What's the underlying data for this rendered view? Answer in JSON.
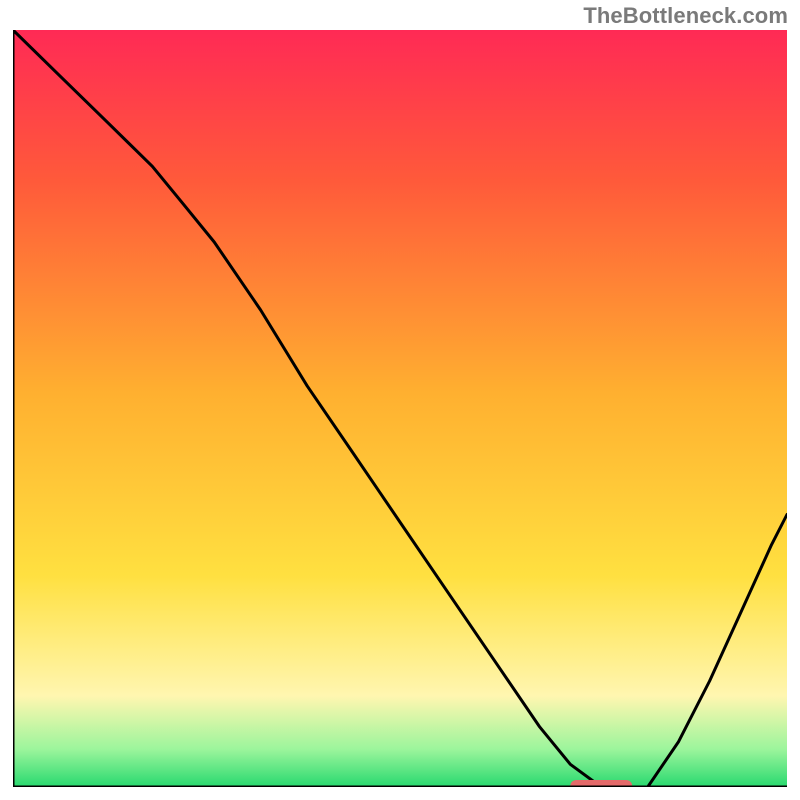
{
  "watermark": "TheBottleneck.com",
  "colors": {
    "gradient_top": "#ff2a55",
    "gradient_upper": "#ff5a3a",
    "gradient_mid": "#ffb030",
    "gradient_low": "#ffe040",
    "gradient_pale": "#fff6b0",
    "gradient_green_light": "#9cf59c",
    "gradient_green": "#28d96f",
    "curve": "#000000",
    "marker": "#e46a6a",
    "axis": "#000000"
  },
  "chart_data": {
    "type": "line",
    "title": "",
    "xlabel": "",
    "ylabel": "",
    "xlim": [
      0,
      100
    ],
    "ylim": [
      0,
      100
    ],
    "series": [
      {
        "name": "bottleneck-curve",
        "x": [
          0,
          6,
          12,
          18,
          22,
          26,
          32,
          38,
          44,
          50,
          56,
          62,
          68,
          72,
          76,
          78,
          82,
          86,
          90,
          94,
          98,
          100
        ],
        "y": [
          100,
          94,
          88,
          82,
          77,
          72,
          63,
          53,
          44,
          35,
          26,
          17,
          8,
          3,
          0,
          0,
          0,
          6,
          14,
          23,
          32,
          36
        ]
      }
    ],
    "marker": {
      "x_start": 72,
      "x_end": 80,
      "y": 0
    },
    "annotations": []
  }
}
